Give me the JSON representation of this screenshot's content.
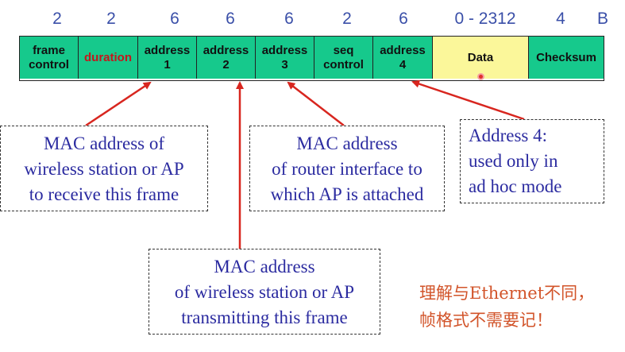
{
  "sizes": [
    "2",
    "2",
    "6",
    "6",
    "6",
    "2",
    "6",
    "0 - 2312",
    "4"
  ],
  "size_unit": "B",
  "fields": [
    {
      "label": "frame\ncontrol",
      "style": "normal"
    },
    {
      "label": "duration",
      "style": "red"
    },
    {
      "label": "address\n1",
      "style": "normal"
    },
    {
      "label": "address\n2",
      "style": "normal"
    },
    {
      "label": "address\n3",
      "style": "normal"
    },
    {
      "label": "seq\ncontrol",
      "style": "normal"
    },
    {
      "label": "address\n4",
      "style": "normal"
    },
    {
      "label": "Data",
      "style": "yellow"
    },
    {
      "label": "Checksum",
      "style": "normal"
    }
  ],
  "callouts": {
    "addr1": "MAC address of\nwireless station or AP\nto receive this frame",
    "addr2": "MAC address\nof wireless station or AP\ntransmitting this frame",
    "addr3": "MAC address\nof router interface to\nwhich AP is attached",
    "addr4": "Address 4:\nused only in\nad hoc mode"
  },
  "note": "理解与Ethernet不同，\n帧格式不需要记！",
  "colors": {
    "field_green": "#16c98c",
    "data_yellow": "#fbf79a",
    "duration_red": "#c4161c",
    "callout_text": "#2b2ba0",
    "note_orange": "#d2542a",
    "arrow_red": "#d8261f"
  }
}
